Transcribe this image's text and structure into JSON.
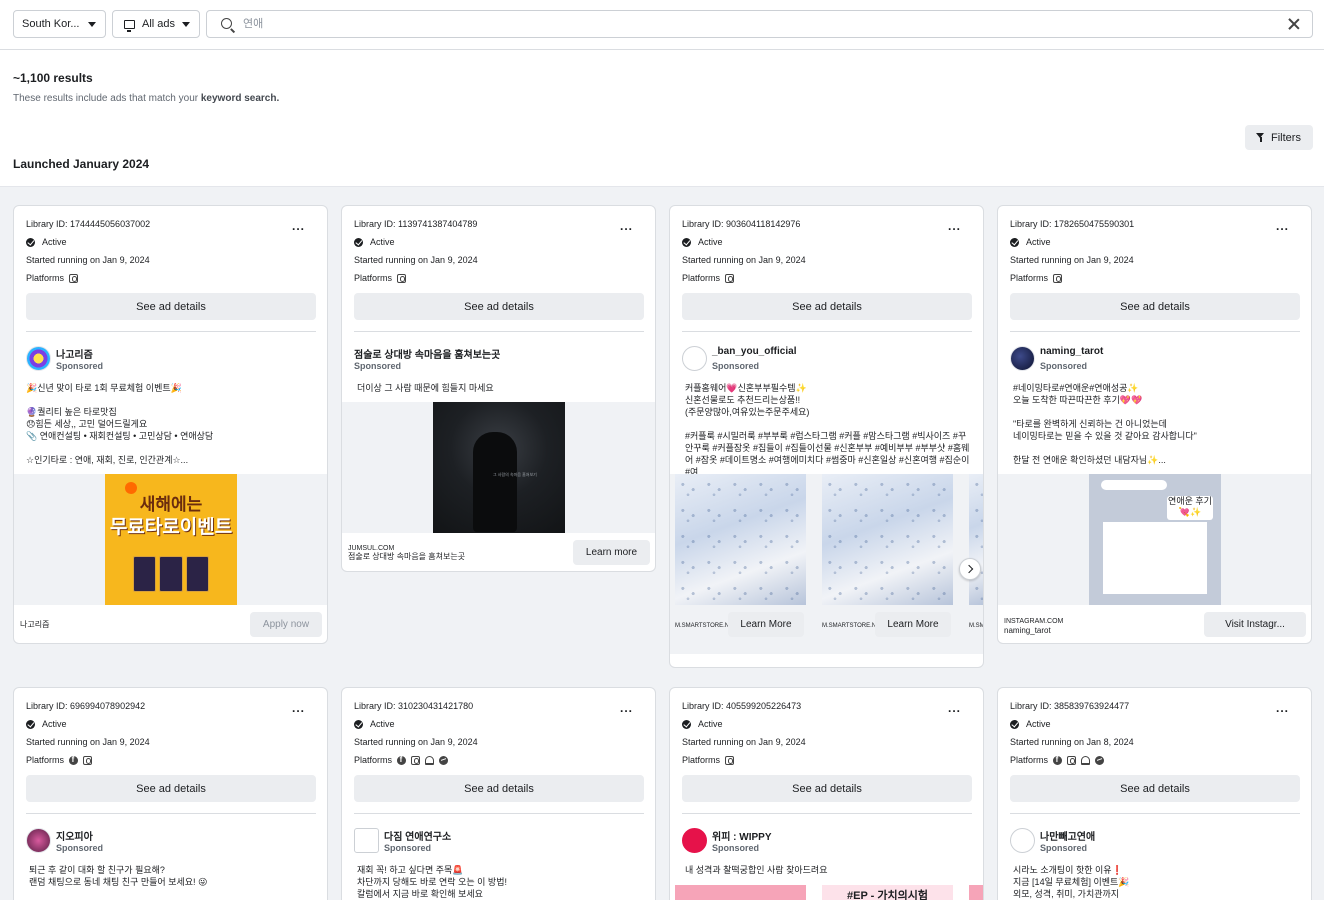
{
  "filters_bar": {
    "country": "South Kor...",
    "ad_type": "All ads",
    "search_placeholder": "연애"
  },
  "results": {
    "count": "~1,100 results",
    "note_prefix": "These results include ads that match your ",
    "note_bold": "keyword search.",
    "filters_label": "Filters",
    "section_title": "Launched January 2024"
  },
  "common": {
    "status": "Active",
    "platforms_label": "Platforms",
    "details_label": "See ad details",
    "sponsored": "Sponsored",
    "more": "..."
  },
  "cards": [
    {
      "library_id": "Library ID: 1744445056037002",
      "started": "Started running on Jan 9, 2024",
      "platforms": [
        "instagram-icon"
      ],
      "page_name": "나고리즘",
      "body": "🎉신년 맞이 타로 1회 무료체험 이벤트🎉\n\n🔮퀄리티 높은 타로맛집\n😞힘든 세상,, 고민 덜어드릴게요\n📎 연애컨설팅 • 재회컨설팅 • 고민상담 • 연애상담\n\n☆인기타로 : 연애, 재회, 진로, 인간관계☆...",
      "poster_line1": "새해에는",
      "poster_line2": "무료타로이벤트",
      "footer": "나고리즘",
      "cta": "Apply now"
    },
    {
      "library_id": "Library ID: 1139741387404789",
      "started": "Started running on Jan 9, 2024",
      "platforms": [
        "instagram-icon"
      ],
      "page_name": "점술로 상대방 속마음을 훔쳐보는곳",
      "body": "더이상 그 사람 때문에 힘들지 마세요",
      "image_text": "그 사람의 속마음\n훔쳐보기",
      "footer_domain": "JUMSUL.COM",
      "footer_title": "점술로 상대방 속마음을 훔쳐보는곳",
      "cta": "Learn more"
    },
    {
      "library_id": "Library ID: 903604118142976",
      "started": "Started running on Jan 9, 2024",
      "platforms": [
        "instagram-icon"
      ],
      "page_name": "_ban_you_official",
      "body": "커플홈웨어💗신혼부부필수템✨\n신혼선물로도 추천드리는상품!!\n(주문양많아,여유있는주문주세요)\n\n#커플룩 #시밀러룩 #부부룩 #럽스타그램 #커플 #맘스타그램 #빅사이즈 #꾸안꾸룩 #커플잠옷 #집들이 #집들이선물 #신혼부부 #예비부부 #부부샷 #홈웨어 #잠옷 #데이트명소 #여행에미치다 #썸중마 #신혼일상 #신혼여행 #집순이 #여...",
      "carousel": [
        {
          "domain": "M.SMARTSTORE.N",
          "cta": "Learn More"
        },
        {
          "domain": "M.SMARTSTORE.N",
          "cta": "Learn More"
        },
        {
          "domain": "M.SM",
          "cta": ""
        }
      ]
    },
    {
      "library_id": "Library ID: 1782650475590301",
      "started": "Started running on Jan 9, 2024",
      "platforms": [
        "instagram-icon"
      ],
      "page_name": "naming_tarot",
      "body": "#네이밍타로#연애운#연애성공✨\n오늘 도착한 따끈따끈한 후기💖💖\n\n\"타로를 완벽하게 신뢰하는 건 아니었는데\n네이밍타로는 믿을 수 있을 것 같아요 감사합니다\"\n\n한달 전 연애운 확인하셨던 내담자님✨...",
      "image_bubble": "연애운\n후기💘✨",
      "footer_domain": "INSTAGRAM.COM",
      "footer_title": "naming_tarot",
      "cta": "Visit Instagr..."
    },
    {
      "library_id": "Library ID: 696994078902942",
      "started": "Started running on Jan 9, 2024",
      "platforms": [
        "facebook-icon",
        "instagram-icon"
      ],
      "page_name": "지오피아",
      "body": "퇴근 후 같이 대화 할 친구가 필요해?\n랜덤 채팅으로 동네 채팅 친구 만들어 보세요! 😜"
    },
    {
      "library_id": "Library ID: 310230431421780",
      "started": "Started running on Jan 9, 2024",
      "platforms": [
        "facebook-icon",
        "instagram-icon",
        "audience-network-icon",
        "messenger-icon"
      ],
      "page_name": "다짐 연애연구소",
      "body": "재회 꼭! 하고 싶다면 주목🚨\n차단까지 당해도 바로 연락 오는 이 방법!\n칼럼에서 지금 바로 확인해 보세요"
    },
    {
      "library_id": "Library ID: 405599205226473",
      "started": "Started running on Jan 9, 2024",
      "platforms": [
        "instagram-icon"
      ],
      "page_name": "위피 : WIPPY",
      "body": "내 성격과 찰떡궁합인 사람 찾아드려요",
      "strip_text": "#EP - 가치의시험"
    },
    {
      "library_id": "Library ID: 385839763924477",
      "started": "Started running on Jan 8, 2024",
      "platforms": [
        "facebook-icon",
        "instagram-icon",
        "audience-network-icon",
        "messenger-icon"
      ],
      "page_name": "나만빼고연애",
      "body": "시라노 소개팅이 핫한 이유❗\n지금 [14일 무료체험] 이벤트🎉\n외모, 성격, 취미, 가치관까지"
    }
  ]
}
